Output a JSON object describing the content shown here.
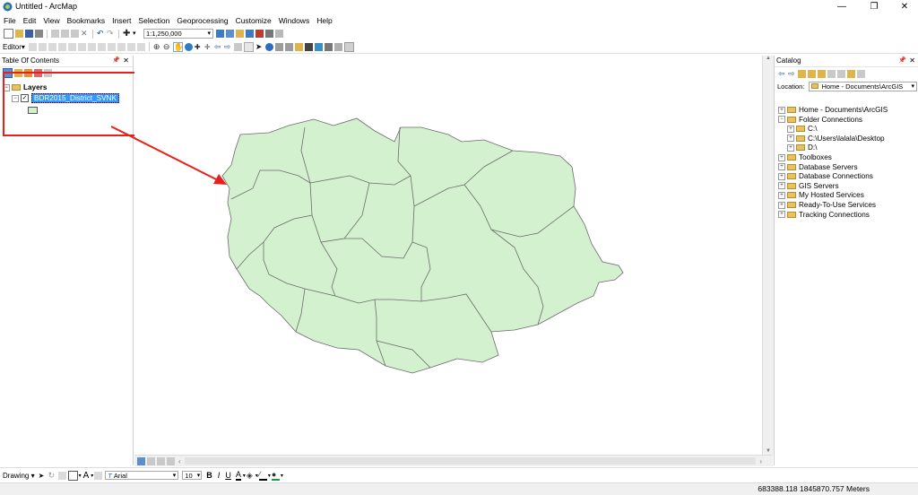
{
  "window": {
    "title": "Untitled - ArcMap",
    "min_glyph": "—",
    "max_glyph": "❐",
    "close_glyph": "✕"
  },
  "menu": [
    "File",
    "Edit",
    "View",
    "Bookmarks",
    "Insert",
    "Selection",
    "Geoprocessing",
    "Customize",
    "Windows",
    "Help"
  ],
  "toolbar": {
    "scale_value": "1:1,250,000",
    "editor_label": "Editor▾"
  },
  "toc": {
    "title": "Table Of Contents",
    "group_label": "Layers",
    "layer_name": "BDR2015_District_SVNK",
    "symbol_color": "#d4f1cf"
  },
  "catalog": {
    "title": "Catalog",
    "location_label": "Location:",
    "location_value": "Home - Documents\\ArcGIS",
    "items": [
      {
        "label": "Home - Documents\\ArcGIS",
        "level": 0,
        "expand": "+"
      },
      {
        "label": "Folder Connections",
        "level": 0,
        "expand": "−"
      },
      {
        "label": "C:\\",
        "level": 1,
        "expand": "+"
      },
      {
        "label": "C:\\Users\\lalala\\Desktop",
        "level": 1,
        "expand": "+"
      },
      {
        "label": "D:\\",
        "level": 1,
        "expand": "+"
      },
      {
        "label": "Toolboxes",
        "level": 0,
        "expand": "+"
      },
      {
        "label": "Database Servers",
        "level": 0,
        "expand": "+"
      },
      {
        "label": "Database Connections",
        "level": 0,
        "expand": "+"
      },
      {
        "label": "GIS Servers",
        "level": 0,
        "expand": "+"
      },
      {
        "label": "My Hosted Services",
        "level": 0,
        "expand": "+"
      },
      {
        "label": "Ready-To-Use Services",
        "level": 0,
        "expand": "+"
      },
      {
        "label": "Tracking Connections",
        "level": 0,
        "expand": "+"
      }
    ]
  },
  "drawing": {
    "label": "Drawing ▾",
    "font_name": "Arial",
    "font_size": "10",
    "bold": "B",
    "italic": "I",
    "underline": "U",
    "text_tool": "A"
  },
  "status": {
    "coordinates": "683388.118  1845870.757 Meters"
  },
  "colors": {
    "district_fill": "#d4f1cf",
    "district_stroke": "#6b6b6b",
    "annotation_red": "#e8201c",
    "selection_blue": "#3399ff"
  }
}
